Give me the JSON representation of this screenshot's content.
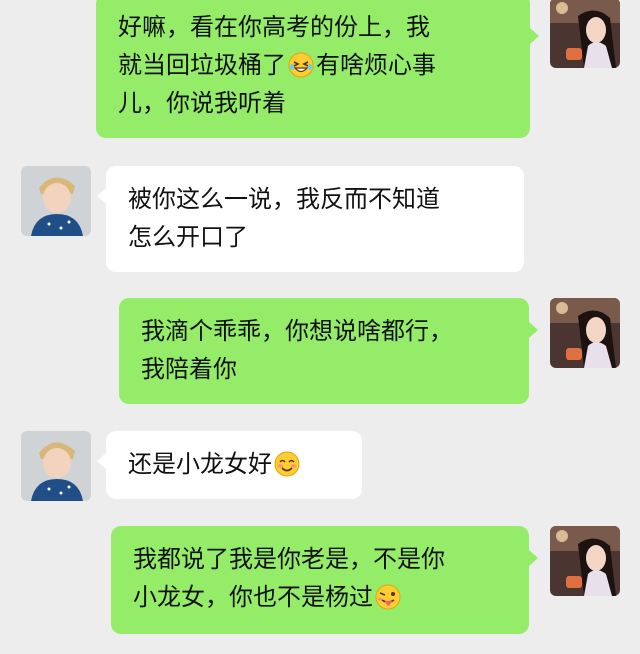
{
  "messages": [
    {
      "side": "right",
      "lines": [
        "好嘛，看在你高考的份上，我",
        "就当回垃圾桶了",
        "有啥烦心事",
        "儿，你说我听着"
      ],
      "emoji": "tearful-grin-emoji"
    },
    {
      "side": "left",
      "lines": [
        "被你这么一说，我反而不知道",
        "怎么开口了"
      ]
    },
    {
      "side": "right",
      "lines": [
        "我滴个乖乖，你想说啥都行，",
        "我陪着你"
      ]
    },
    {
      "side": "left",
      "lines": [
        "还是小龙女好"
      ],
      "emoji": "blushing-smile-emoji"
    },
    {
      "side": "right",
      "lines": [
        "我都说了我是你老是，不是你",
        "小龙女，你也不是杨过"
      ],
      "emoji": "tongue-out-emoji"
    }
  ],
  "colors": {
    "background": "#ededed",
    "outgoing_bubble": "#95ec69",
    "incoming_bubble": "#ffffff",
    "text": "#111111"
  }
}
